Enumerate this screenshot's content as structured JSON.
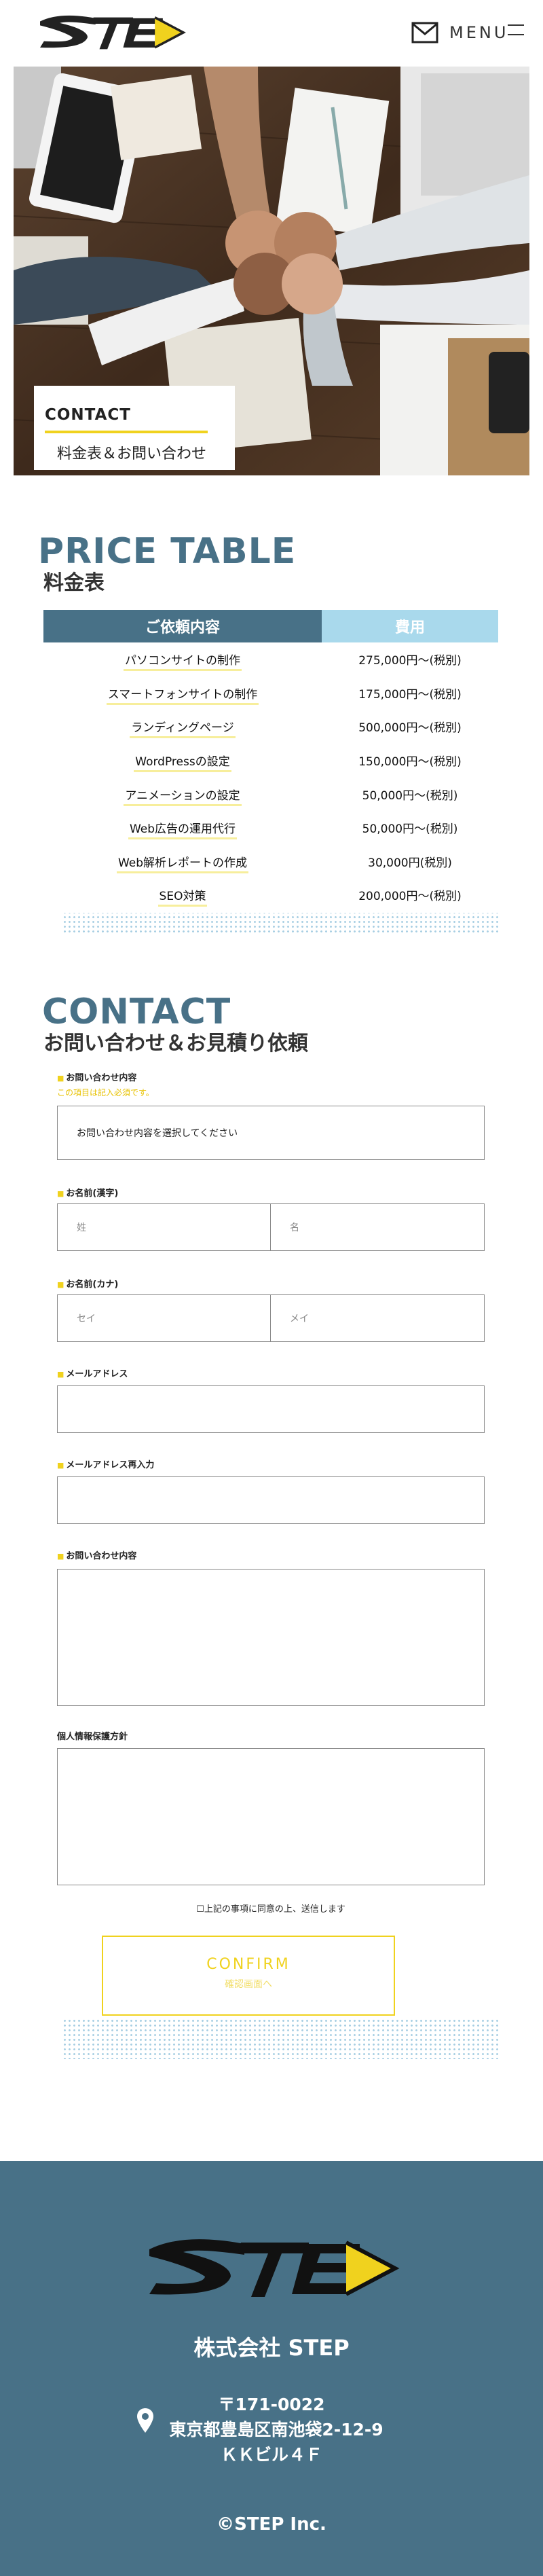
{
  "header": {
    "logo_text": "STEP",
    "menu_label": "MENU"
  },
  "hero": {
    "label_en": "CONTACT",
    "label_ja": "料金表＆お問い合わせ"
  },
  "price_section": {
    "title_en": "PRICE TABLE",
    "title_ja": "料金表",
    "columns": [
      "ご依頼内容",
      "費用"
    ],
    "rows": [
      {
        "item": "パソコンサイトの制作",
        "price": "275,000円〜(税別)"
      },
      {
        "item": "スマートフォンサイトの制作",
        "price": "175,000円〜(税別)"
      },
      {
        "item": "ランディングページ",
        "price": "500,000円〜(税別)"
      },
      {
        "item": "WordPressの設定",
        "price": "150,000円〜(税別)"
      },
      {
        "item": "アニメーションの設定",
        "price": "50,000円〜(税別)"
      },
      {
        "item": "Web広告の運用代行",
        "price": "50,000円〜(税別)"
      },
      {
        "item": "Web解析レポートの作成",
        "price": "30,000円(税別)"
      },
      {
        "item": "SEO対策",
        "price": "200,000円〜(税別)"
      }
    ]
  },
  "contact_section": {
    "title_en": "CONTACT",
    "title_ja": "お問い合わせ＆お見積り依頼",
    "required_mark": "■",
    "inquiry_label": "お問い合わせ内容",
    "inquiry_note": "この項目は記入必須です。",
    "inquiry_select": "お問い合わせ内容を選択してください",
    "name_label": "お名前(漢字)",
    "last_name_placeholder": "姓",
    "first_name_placeholder": "名",
    "kana_label": "お名前(カナ)",
    "last_kana_placeholder": "セイ",
    "first_kana_placeholder": "メイ",
    "email_label": "メールアドレス",
    "email_confirm_label": "メールアドレス再入力",
    "message_label": "お問い合わせ内容",
    "privacy_label": "個人情報保護方針",
    "agree_text": "☐上記の事項に同意の上、送信します",
    "confirm_en": "CONFIRM",
    "confirm_ja": "確認画面へ"
  },
  "footer": {
    "company": "株式会社 STEP",
    "postal": "〒171-0022",
    "address1": "東京都豊島区南池袋2-12-9",
    "address2": "ＫＫビル４Ｆ",
    "copyright": "©STEP Inc."
  },
  "colors": {
    "brand_blue": "#487187",
    "light_blue": "#a9d9ec",
    "accent_yellow": "#f0d21e"
  }
}
